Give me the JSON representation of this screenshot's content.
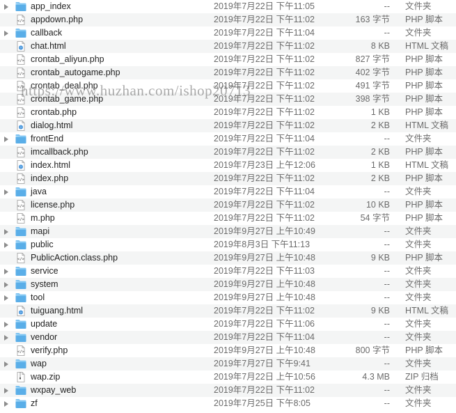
{
  "files": [
    {
      "name": "app_index",
      "date": "2019年7月22日 下午11:05",
      "size": "--",
      "kind": "文件夹",
      "type": "folder"
    },
    {
      "name": "appdown.php",
      "date": "2019年7月22日 下午11:02",
      "size": "163 字节",
      "kind": "PHP 脚本",
      "type": "php"
    },
    {
      "name": "callback",
      "date": "2019年7月22日 下午11:04",
      "size": "--",
      "kind": "文件夹",
      "type": "folder"
    },
    {
      "name": "chat.html",
      "date": "2019年7月22日 下午11:02",
      "size": "8 KB",
      "kind": "HTML 文稿",
      "type": "html"
    },
    {
      "name": "crontab_aliyun.php",
      "date": "2019年7月22日 下午11:02",
      "size": "827 字节",
      "kind": "PHP 脚本",
      "type": "php"
    },
    {
      "name": "crontab_autogame.php",
      "date": "2019年7月22日 下午11:02",
      "size": "402 字节",
      "kind": "PHP 脚本",
      "type": "php"
    },
    {
      "name": "crontab_deal.php",
      "date": "2019年7月22日 下午11:02",
      "size": "491 字节",
      "kind": "PHP 脚本",
      "type": "php"
    },
    {
      "name": "crontab_game.php",
      "date": "2019年7月22日 下午11:02",
      "size": "398 字节",
      "kind": "PHP 脚本",
      "type": "php"
    },
    {
      "name": "crontab.php",
      "date": "2019年7月22日 下午11:02",
      "size": "1 KB",
      "kind": "PHP 脚本",
      "type": "php"
    },
    {
      "name": "dialog.html",
      "date": "2019年7月22日 下午11:02",
      "size": "2 KB",
      "kind": "HTML 文稿",
      "type": "html"
    },
    {
      "name": "frontEnd",
      "date": "2019年7月22日 下午11:04",
      "size": "--",
      "kind": "文件夹",
      "type": "folder"
    },
    {
      "name": "imcallback.php",
      "date": "2019年7月22日 下午11:02",
      "size": "2 KB",
      "kind": "PHP 脚本",
      "type": "php"
    },
    {
      "name": "index.html",
      "date": "2019年7月23日 上午12:06",
      "size": "1 KB",
      "kind": "HTML 文稿",
      "type": "html"
    },
    {
      "name": "index.php",
      "date": "2019年7月22日 下午11:02",
      "size": "2 KB",
      "kind": "PHP 脚本",
      "type": "php"
    },
    {
      "name": "java",
      "date": "2019年7月22日 下午11:04",
      "size": "--",
      "kind": "文件夹",
      "type": "folder"
    },
    {
      "name": "license.php",
      "date": "2019年7月22日 下午11:02",
      "size": "10 KB",
      "kind": "PHP 脚本",
      "type": "php"
    },
    {
      "name": "m.php",
      "date": "2019年7月22日 下午11:02",
      "size": "54 字节",
      "kind": "PHP 脚本",
      "type": "php"
    },
    {
      "name": "mapi",
      "date": "2019年9月27日 上午10:49",
      "size": "--",
      "kind": "文件夹",
      "type": "folder"
    },
    {
      "name": "public",
      "date": "2019年8月3日 下午11:13",
      "size": "--",
      "kind": "文件夹",
      "type": "folder"
    },
    {
      "name": "PublicAction.class.php",
      "date": "2019年9月27日 上午10:48",
      "size": "9 KB",
      "kind": "PHP 脚本",
      "type": "php"
    },
    {
      "name": "service",
      "date": "2019年7月22日 下午11:03",
      "size": "--",
      "kind": "文件夹",
      "type": "folder"
    },
    {
      "name": "system",
      "date": "2019年9月27日 上午10:48",
      "size": "--",
      "kind": "文件夹",
      "type": "folder"
    },
    {
      "name": "tool",
      "date": "2019年9月27日 上午10:48",
      "size": "--",
      "kind": "文件夹",
      "type": "folder"
    },
    {
      "name": "tuiguang.html",
      "date": "2019年7月22日 下午11:02",
      "size": "9 KB",
      "kind": "HTML 文稿",
      "type": "html"
    },
    {
      "name": "update",
      "date": "2019年7月22日 下午11:06",
      "size": "--",
      "kind": "文件夹",
      "type": "folder"
    },
    {
      "name": "vendor",
      "date": "2019年7月22日 下午11:04",
      "size": "--",
      "kind": "文件夹",
      "type": "folder"
    },
    {
      "name": "verify.php",
      "date": "2019年9月27日 上午10:48",
      "size": "800 字节",
      "kind": "PHP 脚本",
      "type": "php"
    },
    {
      "name": "wap",
      "date": "2019年7月27日 下午9:41",
      "size": "--",
      "kind": "文件夹",
      "type": "folder"
    },
    {
      "name": "wap.zip",
      "date": "2019年7月22日 上午10:56",
      "size": "4.3 MB",
      "kind": "ZIP 归档",
      "type": "zip"
    },
    {
      "name": "wxpay_web",
      "date": "2019年7月22日 下午11:02",
      "size": "--",
      "kind": "文件夹",
      "type": "folder"
    },
    {
      "name": "zf",
      "date": "2019年7月25日 下午8:05",
      "size": "--",
      "kind": "文件夹",
      "type": "folder"
    }
  ],
  "watermark": "https://www.huzhan.com/ishop20713",
  "icons": {
    "folder": "folder-icon",
    "php": "php-script-icon",
    "html": "html-document-icon",
    "zip": "zip-archive-icon"
  },
  "colors": {
    "folder": "#5aaee8",
    "folder_tab": "#7cc3f2",
    "row_alt": "#f4f5f5",
    "secondary_text": "#6b6b6b"
  }
}
